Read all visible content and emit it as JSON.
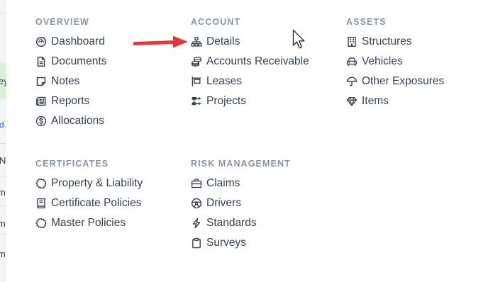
{
  "underlay": {
    "fragments": [
      "ey",
      "d",
      "N",
      "m",
      "m",
      "m"
    ]
  },
  "sections": {
    "overview": {
      "title": "OVERVIEW",
      "items": [
        {
          "label": "Dashboard",
          "icon": "dashboard-gauge-icon"
        },
        {
          "label": "Documents",
          "icon": "document-icon"
        },
        {
          "label": "Notes",
          "icon": "note-icon"
        },
        {
          "label": "Reports",
          "icon": "newspaper-report-icon"
        },
        {
          "label": "Allocations",
          "icon": "dollar-circle-icon"
        }
      ]
    },
    "account": {
      "title": "ACCOUNT",
      "items": [
        {
          "label": "Details",
          "icon": "sitemap-icon"
        },
        {
          "label": "Accounts Receivable",
          "icon": "coins-stack-icon"
        },
        {
          "label": "Leases",
          "icon": "lease-sign-icon"
        },
        {
          "label": "Projects",
          "icon": "project-tasks-icon"
        }
      ]
    },
    "assets": {
      "title": "ASSETS",
      "items": [
        {
          "label": "Structures",
          "icon": "building-icon"
        },
        {
          "label": "Vehicles",
          "icon": "car-icon"
        },
        {
          "label": "Other Exposures",
          "icon": "umbrella-icon"
        },
        {
          "label": "Items",
          "icon": "gem-icon"
        }
      ]
    },
    "certificates": {
      "title": "CERTIFICATES",
      "items": [
        {
          "label": "Property & Liability",
          "icon": "certificate-badge-icon"
        },
        {
          "label": "Certificate Policies",
          "icon": "policy-book-icon"
        },
        {
          "label": "Master Policies",
          "icon": "certificate-badge-icon"
        }
      ]
    },
    "risk_management": {
      "title": "RISK MANAGEMENT",
      "items": [
        {
          "label": "Claims",
          "icon": "briefcase-icon"
        },
        {
          "label": "Drivers",
          "icon": "steering-wheel-icon"
        },
        {
          "label": "Standards",
          "icon": "lightning-bolt-icon"
        },
        {
          "label": "Surveys",
          "icon": "clipboard-icon"
        }
      ]
    }
  },
  "colors": {
    "section_title": "#8a93a0",
    "item_text": "#364152",
    "icon": "#364152",
    "annotation_arrow": "#e5383b"
  }
}
